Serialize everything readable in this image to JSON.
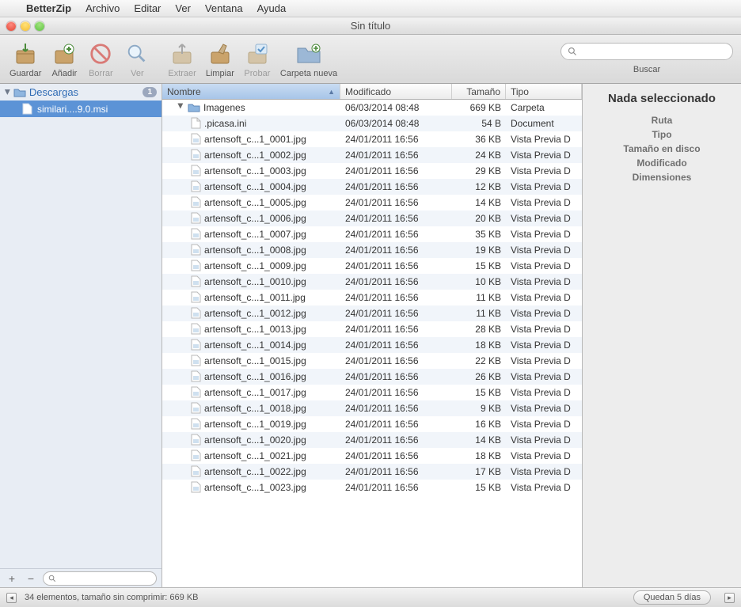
{
  "menubar": {
    "apple": "",
    "app": "BetterZip",
    "items": [
      "Archivo",
      "Editar",
      "Ver",
      "Ventana",
      "Ayuda"
    ]
  },
  "window": {
    "title": "Sin título"
  },
  "toolbar": {
    "save": "Guardar",
    "add": "Añadir",
    "delete": "Borrar",
    "view": "Ver",
    "extract": "Extraer",
    "clean": "Limpiar",
    "test": "Probar",
    "newfolder": "Carpeta nueva",
    "search_label": "Buscar",
    "search_placeholder": ""
  },
  "sidebar": {
    "root": {
      "name": "Descargas",
      "badge": "1"
    },
    "child": {
      "name": "similari....9.0.msi"
    },
    "add": "+",
    "remove": "−"
  },
  "columns": {
    "name": "Nombre",
    "modified": "Modificado",
    "size": "Tamaño",
    "type": "Tipo"
  },
  "rows": [
    {
      "name": "Imagenes",
      "modified": "06/03/2014 08:48",
      "size": "669 KB",
      "type": "Carpeta",
      "icon": "folder",
      "indent": 1,
      "disclosure": true
    },
    {
      "name": ".picasa.ini",
      "modified": "06/03/2014 08:48",
      "size": "54 B",
      "type": "Document",
      "icon": "doc",
      "indent": 2
    },
    {
      "name": "artensoft_c...1_0001.jpg",
      "modified": "24/01/2011 16:56",
      "size": "36 KB",
      "type": "Vista Previa D",
      "icon": "img",
      "indent": 2
    },
    {
      "name": "artensoft_c...1_0002.jpg",
      "modified": "24/01/2011 16:56",
      "size": "24 KB",
      "type": "Vista Previa D",
      "icon": "img",
      "indent": 2
    },
    {
      "name": "artensoft_c...1_0003.jpg",
      "modified": "24/01/2011 16:56",
      "size": "29 KB",
      "type": "Vista Previa D",
      "icon": "img",
      "indent": 2
    },
    {
      "name": "artensoft_c...1_0004.jpg",
      "modified": "24/01/2011 16:56",
      "size": "12 KB",
      "type": "Vista Previa D",
      "icon": "img",
      "indent": 2
    },
    {
      "name": "artensoft_c...1_0005.jpg",
      "modified": "24/01/2011 16:56",
      "size": "14 KB",
      "type": "Vista Previa D",
      "icon": "img",
      "indent": 2
    },
    {
      "name": "artensoft_c...1_0006.jpg",
      "modified": "24/01/2011 16:56",
      "size": "20 KB",
      "type": "Vista Previa D",
      "icon": "img",
      "indent": 2
    },
    {
      "name": "artensoft_c...1_0007.jpg",
      "modified": "24/01/2011 16:56",
      "size": "35 KB",
      "type": "Vista Previa D",
      "icon": "img",
      "indent": 2
    },
    {
      "name": "artensoft_c...1_0008.jpg",
      "modified": "24/01/2011 16:56",
      "size": "19 KB",
      "type": "Vista Previa D",
      "icon": "img",
      "indent": 2
    },
    {
      "name": "artensoft_c...1_0009.jpg",
      "modified": "24/01/2011 16:56",
      "size": "15 KB",
      "type": "Vista Previa D",
      "icon": "img",
      "indent": 2
    },
    {
      "name": "artensoft_c...1_0010.jpg",
      "modified": "24/01/2011 16:56",
      "size": "10 KB",
      "type": "Vista Previa D",
      "icon": "img",
      "indent": 2
    },
    {
      "name": "artensoft_c...1_0011.jpg",
      "modified": "24/01/2011 16:56",
      "size": "11 KB",
      "type": "Vista Previa D",
      "icon": "img",
      "indent": 2
    },
    {
      "name": "artensoft_c...1_0012.jpg",
      "modified": "24/01/2011 16:56",
      "size": "11 KB",
      "type": "Vista Previa D",
      "icon": "img",
      "indent": 2
    },
    {
      "name": "artensoft_c...1_0013.jpg",
      "modified": "24/01/2011 16:56",
      "size": "28 KB",
      "type": "Vista Previa D",
      "icon": "img",
      "indent": 2
    },
    {
      "name": "artensoft_c...1_0014.jpg",
      "modified": "24/01/2011 16:56",
      "size": "18 KB",
      "type": "Vista Previa D",
      "icon": "img",
      "indent": 2
    },
    {
      "name": "artensoft_c...1_0015.jpg",
      "modified": "24/01/2011 16:56",
      "size": "22 KB",
      "type": "Vista Previa D",
      "icon": "img",
      "indent": 2
    },
    {
      "name": "artensoft_c...1_0016.jpg",
      "modified": "24/01/2011 16:56",
      "size": "26 KB",
      "type": "Vista Previa D",
      "icon": "img",
      "indent": 2
    },
    {
      "name": "artensoft_c...1_0017.jpg",
      "modified": "24/01/2011 16:56",
      "size": "15 KB",
      "type": "Vista Previa D",
      "icon": "img",
      "indent": 2
    },
    {
      "name": "artensoft_c...1_0018.jpg",
      "modified": "24/01/2011 16:56",
      "size": "9 KB",
      "type": "Vista Previa D",
      "icon": "img",
      "indent": 2
    },
    {
      "name": "artensoft_c...1_0019.jpg",
      "modified": "24/01/2011 16:56",
      "size": "16 KB",
      "type": "Vista Previa D",
      "icon": "img",
      "indent": 2
    },
    {
      "name": "artensoft_c...1_0020.jpg",
      "modified": "24/01/2011 16:56",
      "size": "14 KB",
      "type": "Vista Previa D",
      "icon": "img",
      "indent": 2
    },
    {
      "name": "artensoft_c...1_0021.jpg",
      "modified": "24/01/2011 16:56",
      "size": "18 KB",
      "type": "Vista Previa D",
      "icon": "img",
      "indent": 2
    },
    {
      "name": "artensoft_c...1_0022.jpg",
      "modified": "24/01/2011 16:56",
      "size": "17 KB",
      "type": "Vista Previa D",
      "icon": "img",
      "indent": 2
    },
    {
      "name": "artensoft_c...1_0023.jpg",
      "modified": "24/01/2011 16:56",
      "size": "15 KB",
      "type": "Vista Previa D",
      "icon": "img",
      "indent": 2
    }
  ],
  "inspector": {
    "title": "Nada seleccionado",
    "labels": [
      "Ruta",
      "Tipo",
      "Tamaño en disco",
      "Modificado",
      "Dimensiones"
    ]
  },
  "status": {
    "text": "34 elementos, tamaño sin comprimir: 669 KB",
    "trial": "Quedan 5 días"
  }
}
